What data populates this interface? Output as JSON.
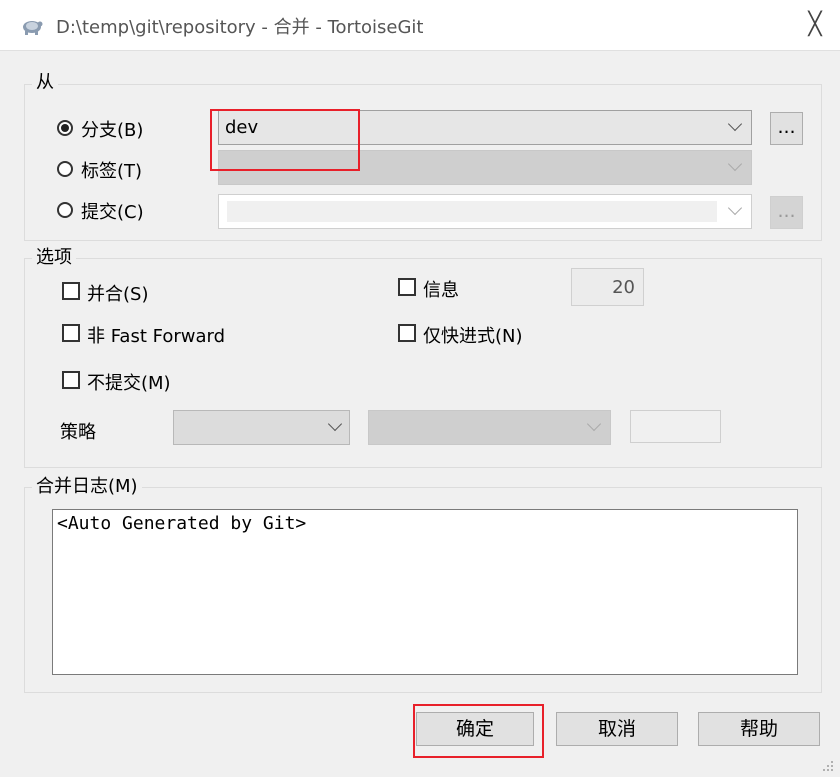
{
  "window": {
    "title": "D:\\temp\\git\\repository - 合并 - TortoiseGit",
    "close_glyph": "╳"
  },
  "from_group": {
    "legend": "从",
    "branch_label": "分支(B)",
    "tag_label": "标签(T)",
    "commit_label": "提交(C)",
    "branch_value": "dev",
    "selected": "branch",
    "browse_glyph": "..."
  },
  "options_group": {
    "legend": "选项",
    "squash_label": "并合(S)",
    "no_ff_label": "非 Fast Forward",
    "no_commit_label": "不提交(M)",
    "message_label": "信息",
    "message_count": "20",
    "ff_only_label": "仅快进式(N)",
    "strategy_label": "策略"
  },
  "merge_log": {
    "legend": "合并日志(M)",
    "text": "<Auto Generated by Git>"
  },
  "buttons": {
    "ok": "确定",
    "cancel": "取消",
    "help": "帮助"
  },
  "colors": {
    "highlight": "#e8202a",
    "background": "#f0f0f0"
  }
}
